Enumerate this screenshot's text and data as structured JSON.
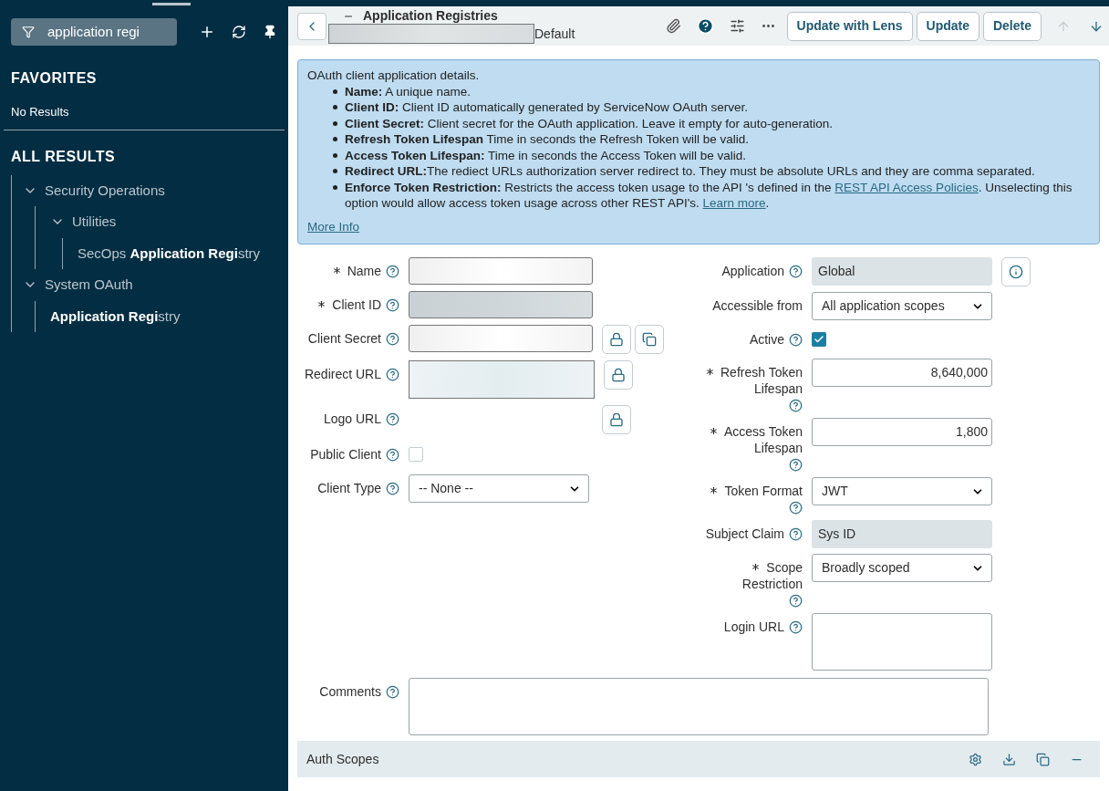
{
  "sidebar": {
    "filter_value": "application regi",
    "favorites": {
      "title": "FAVORITES",
      "empty": "No Results"
    },
    "all_results": {
      "title": "ALL RESULTS",
      "tree": [
        {
          "label": "Security Operations",
          "expanded": true,
          "children": [
            {
              "label": "Utilities",
              "expanded": true,
              "children": [
                {
                  "label": "SecOps **Application Regi**stry"
                }
              ]
            }
          ]
        },
        {
          "label": "System OAuth",
          "expanded": true,
          "children": [
            {
              "label": "**Application Regi**stry"
            }
          ]
        }
      ]
    }
  },
  "header": {
    "title": "Application Registries",
    "subtitle": "Default",
    "buttons": [
      "Update with Lens",
      "Update",
      "Delete"
    ],
    "previous_disabled": true,
    "next_disabled": false
  },
  "info": {
    "intro": "OAuth client application details.",
    "items": [
      {
        "term": "Name:",
        "parts": [
          {
            "kind": "text",
            "text": " A unique name."
          }
        ]
      },
      {
        "term": "Client ID:",
        "parts": [
          {
            "kind": "text",
            "text": " Client ID automatically generated by ServiceNow OAuth server."
          }
        ]
      },
      {
        "term": "Client Secret:",
        "parts": [
          {
            "kind": "text",
            "text": " Client secret for the OAuth application. Leave it empty for auto-generation."
          }
        ]
      },
      {
        "term": "Refresh Token Lifespan",
        "parts": [
          {
            "kind": "text",
            "text": " Time in seconds the Refresh Token will be valid."
          }
        ]
      },
      {
        "term": "Access Token Lifespan:",
        "parts": [
          {
            "kind": "text",
            "text": " Time in seconds the Access Token will be valid."
          }
        ]
      },
      {
        "term": "Redirect URL:",
        "parts": [
          {
            "kind": "text",
            "text": "The rediect URLs authorization server redirect to. They must be absolute URLs and they are comma separated."
          }
        ]
      },
      {
        "term": "Enforce Token Restriction:",
        "parts": [
          {
            "kind": "text",
            "text": " Restricts the access token usage to the API 's defined in the "
          },
          {
            "kind": "link",
            "text": "REST API Access Policies"
          },
          {
            "kind": "text",
            "text": ". Unselecting this option would allow access token usage across other REST API's. "
          },
          {
            "kind": "link",
            "text": "Learn more"
          },
          {
            "kind": "text",
            "text": "."
          }
        ]
      }
    ],
    "more_info": "More Info"
  },
  "form": {
    "left": [
      {
        "kind": "masked",
        "label": "Name",
        "required": true,
        "help": true,
        "readonly": false
      },
      {
        "kind": "masked",
        "label": "Client ID",
        "required": true,
        "help": true,
        "readonly": true
      },
      {
        "kind": "masked",
        "label": "Client Secret",
        "required": false,
        "help": true,
        "readonly": false,
        "lock": true,
        "copy": true
      },
      {
        "kind": "masked_tall",
        "label": "Redirect URL",
        "required": false,
        "help": true,
        "readonly": false,
        "lock": true
      },
      {
        "kind": "empty",
        "label": "Logo URL",
        "required": false,
        "help": true,
        "lock": true
      },
      {
        "kind": "checkbox",
        "label": "Public Client",
        "required": false,
        "help": true,
        "checked": false
      },
      {
        "kind": "select",
        "label": "Client Type",
        "required": false,
        "help": true,
        "value": "-- None --"
      }
    ],
    "right": [
      {
        "kind": "readonly",
        "label": "Application",
        "required": false,
        "help": true,
        "value": "Global",
        "info": true
      },
      {
        "kind": "select",
        "label": "Accessible from",
        "required": false,
        "help": false,
        "value": "All application scopes"
      },
      {
        "kind": "checkbox",
        "label": "Active",
        "required": false,
        "help": true,
        "checked": true
      },
      {
        "kind": "number",
        "label": "Refresh Token Lifespan",
        "required": true,
        "help": true,
        "value": "8,640,000"
      },
      {
        "kind": "number",
        "label": "Access Token Lifespan",
        "required": true,
        "help": true,
        "value": "1,800"
      },
      {
        "kind": "select",
        "label": "Token Format",
        "required": true,
        "help": true,
        "value": "JWT"
      },
      {
        "kind": "readonly",
        "label": "Subject Claim",
        "required": false,
        "help": true,
        "value": "Sys ID"
      },
      {
        "kind": "select",
        "label": "Scope Restriction",
        "required": true,
        "help": true,
        "value": "Broadly scoped"
      },
      {
        "kind": "textarea",
        "label": "Login URL",
        "required": false,
        "help": true
      }
    ],
    "comments": {
      "label": "Comments",
      "help": true
    }
  },
  "related_list": {
    "title": "Auth Scopes"
  }
}
